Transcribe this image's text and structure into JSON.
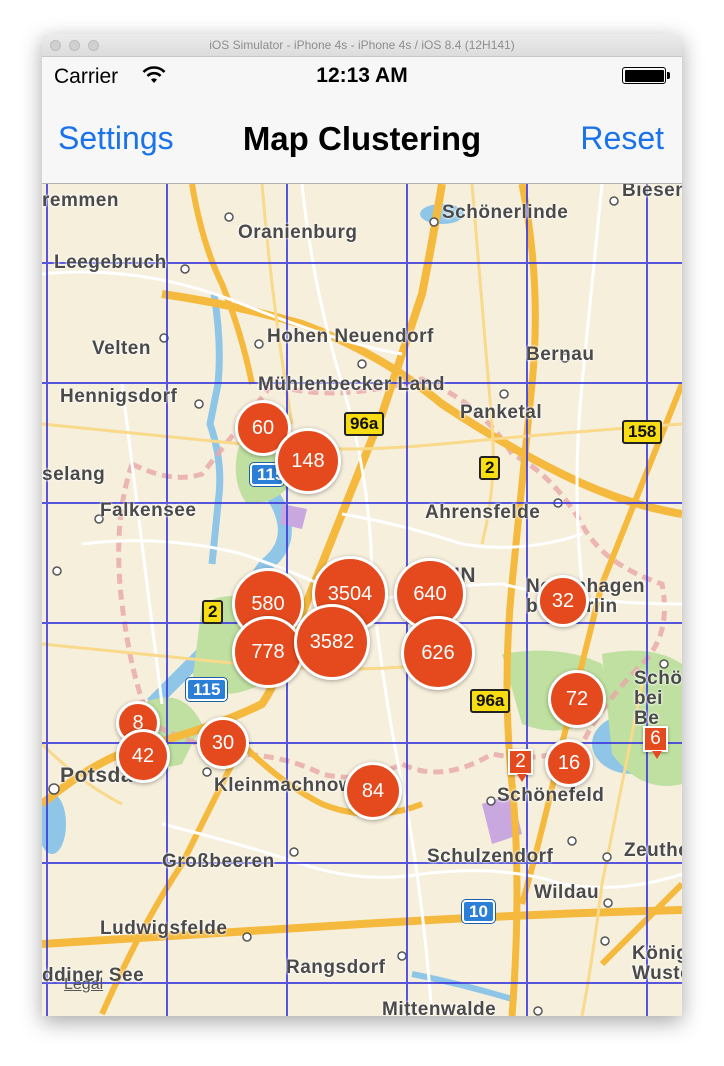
{
  "simulator": {
    "title": "iOS Simulator - iPhone 4s - iPhone 4s / iOS 8.4 (12H141)"
  },
  "status_bar": {
    "carrier": "Carrier",
    "time": "12:13 AM"
  },
  "nav": {
    "left_button": "Settings",
    "title": "Map Clustering",
    "right_button": "Reset"
  },
  "map": {
    "legal": "Legal",
    "places": [
      "remmen",
      "Oranienburg",
      "Schönerlinde",
      "Biesen",
      "Leegebruch",
      "Hohen Neuendorf",
      "Bernau",
      "Velten",
      "Mühlenbecker Land",
      "Hennigsdorf",
      "Panketal",
      "Ahrensfelde",
      "selang",
      "Falkensee",
      "Neuenhagen bei Berlin",
      "IN",
      "Schöne bei Be",
      "Potsdam",
      "Kleinmachnow",
      "Schönefeld",
      "Großbeeren",
      "Schulzendorf",
      "Zeuthe",
      "Wildau",
      "Ludwigsfelde",
      "Königs Wuster",
      "Rangsdorf",
      "ddiner See",
      "Mittenwalde"
    ],
    "road_shields": [
      "96a",
      "158",
      "2",
      "2",
      "115",
      "96a",
      "10",
      "115"
    ],
    "clusters": [
      "60",
      "148",
      "580",
      "3504",
      "640",
      "32",
      "778",
      "3582",
      "626",
      "72",
      "8",
      "42",
      "30",
      "16",
      "84"
    ],
    "pins": [
      "6",
      "2"
    ]
  },
  "colors": {
    "accent": "#1a73e8",
    "cluster": "#e44a1d",
    "grid": "#3b3bdd"
  }
}
